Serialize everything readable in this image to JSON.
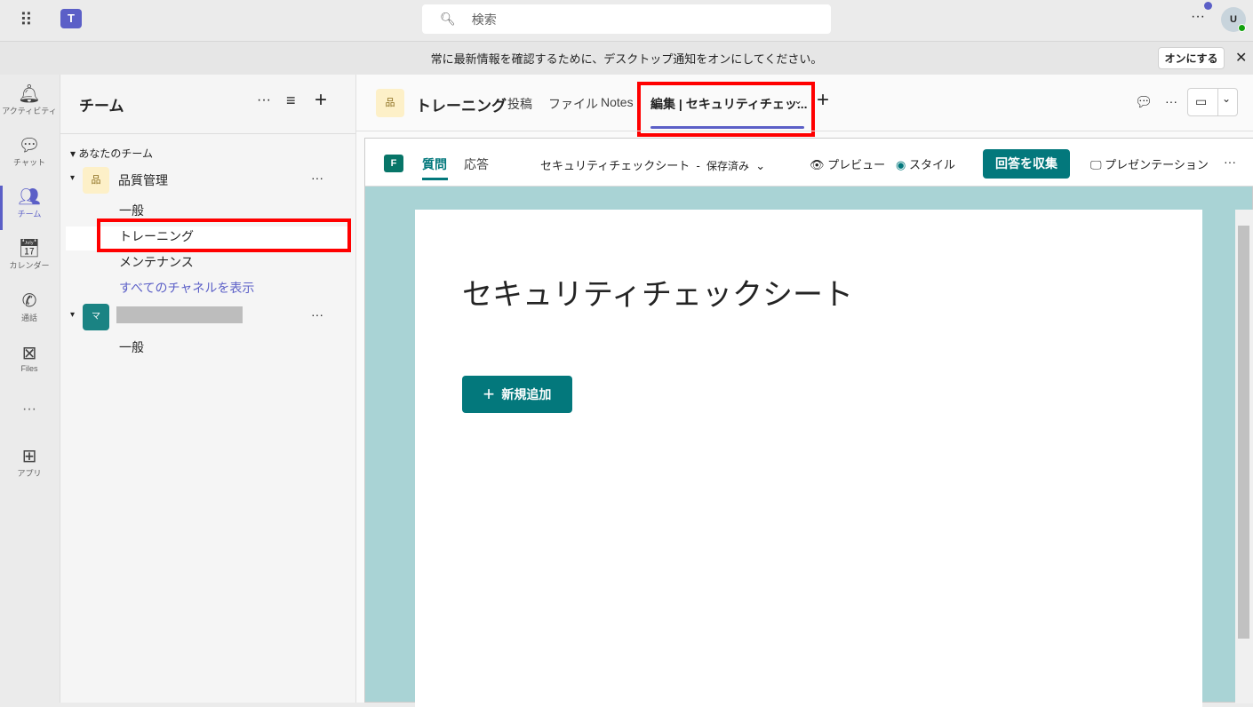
{
  "topbar": {
    "search_placeholder": "検索",
    "avatar": "U"
  },
  "notice": {
    "text": "常に最新情報を確認するために、デスクトップ通知をオンにしてください。",
    "button": "オンにする"
  },
  "rail": [
    {
      "label": "アクティビティ",
      "icon": "bell-icon"
    },
    {
      "label": "チャット",
      "icon": "chat-icon"
    },
    {
      "label": "チーム",
      "icon": "teams-icon"
    },
    {
      "label": "カレンダー",
      "icon": "calendar-icon"
    },
    {
      "label": "通話",
      "icon": "phone-icon"
    },
    {
      "label": "Files",
      "icon": "files-icon"
    },
    {
      "label": "アプリ",
      "icon": "apps-icon"
    }
  ],
  "teams": {
    "title": "チーム",
    "section": "あなたのチーム",
    "team1": {
      "avatar": "品",
      "name": "品質管理",
      "channels": [
        "一般",
        "トレーニング",
        "メンテナンス"
      ],
      "show_all": "すべてのチャネルを表示"
    },
    "team2": {
      "avatar": "マ",
      "channels": [
        "一般"
      ]
    }
  },
  "channel": {
    "avatar": "品",
    "name": "トレーニング",
    "tabs": [
      "投稿",
      "ファイル",
      "Notes"
    ],
    "active_tab": "編集 | セキュリティチェッ..."
  },
  "forms": {
    "tab_questions": "質問",
    "tab_responses": "応答",
    "doc_title": "セキュリティチェックシート",
    "sep": "-",
    "status": "保存済み",
    "preview": "プレビュー",
    "style": "スタイル",
    "collect": "回答を収集",
    "present": "プレゼンテーション",
    "form_title": "セキュリティチェックシート",
    "add_new": "新規追加"
  },
  "colors": {
    "accent": "#5b5fc7",
    "forms_teal": "#03787c",
    "highlight": "#ff0000"
  }
}
